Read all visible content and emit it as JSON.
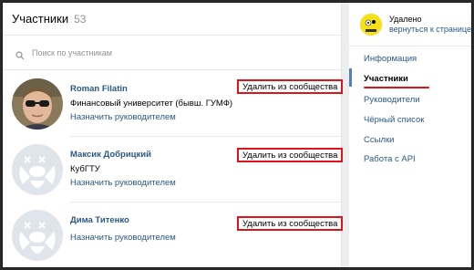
{
  "header": {
    "title": "Участники",
    "count": "53"
  },
  "search": {
    "placeholder": "Поиск по участникам"
  },
  "members": [
    {
      "name": "Roman Filatin",
      "subtitle": "Финансовый университет (бывш. ГУМФ)",
      "link": "Назначить руководителем",
      "remove": "Удалить из сообщества"
    },
    {
      "name": "Максик Добрицкий",
      "subtitle": "КубГТУ",
      "link": "Назначить руководителем",
      "remove": "Удалить из сообщества"
    },
    {
      "name": "Дима Титенко",
      "subtitle": "",
      "link": "Назначить руководителем",
      "remove": "Удалить из сообщества"
    }
  ],
  "sidebar": {
    "status": "Удалено",
    "return_link": "вернуться к странице",
    "items": [
      {
        "label": "Информация"
      },
      {
        "label": "Участники"
      },
      {
        "label": "Руководители"
      },
      {
        "label": "Чёрный список"
      },
      {
        "label": "Ссылки"
      },
      {
        "label": "Работа с API"
      }
    ],
    "active": "Участники"
  },
  "colors": {
    "link": "#2a5885",
    "highlight": "#e0121a",
    "active_bar": "#5181b8"
  }
}
